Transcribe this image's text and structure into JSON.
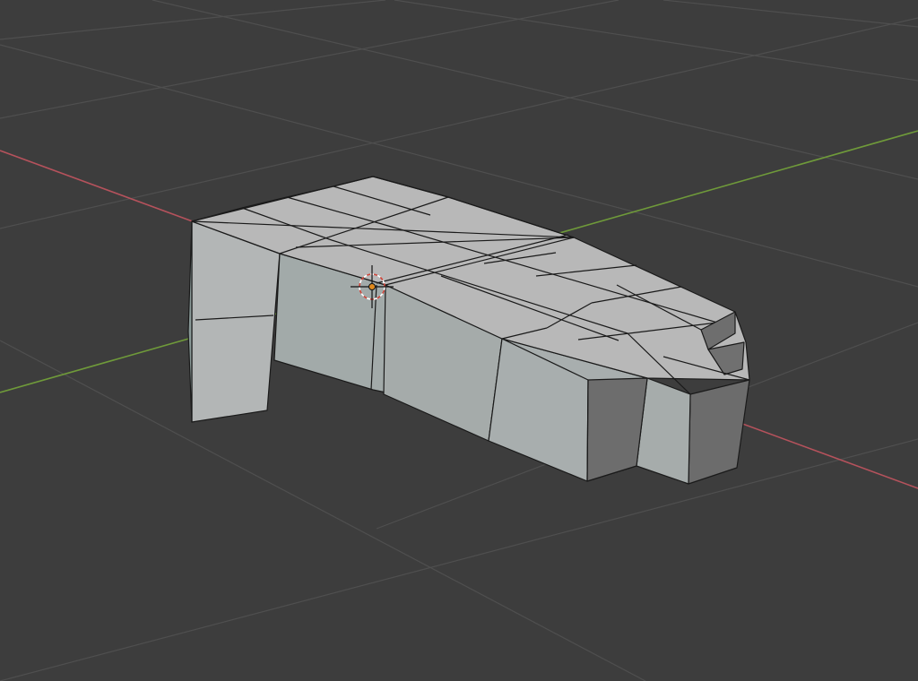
{
  "viewport": {
    "background": "#3d3d3d",
    "view": "3d-perspective",
    "grid": {
      "visible": true,
      "line_color": "#4f4f4f"
    },
    "axes": {
      "x_axis_color": "#b5525c",
      "y_axis_color": "#6f9a3a"
    },
    "mesh": {
      "name_hint": "mesh-object",
      "mode": "object-mode",
      "face_color_top": "#b9b9b9",
      "face_color_side": "#a4aaa9",
      "face_color_front": "#6e6e6e",
      "edge_color": "#1a1a1a"
    },
    "cursor_3d": {
      "icon": "3d-cursor-icon",
      "ring_color_a": "#ffffff",
      "ring_color_b": "#d0453a"
    },
    "origin": {
      "icon": "object-origin-icon",
      "color": "#e08a1e"
    }
  }
}
